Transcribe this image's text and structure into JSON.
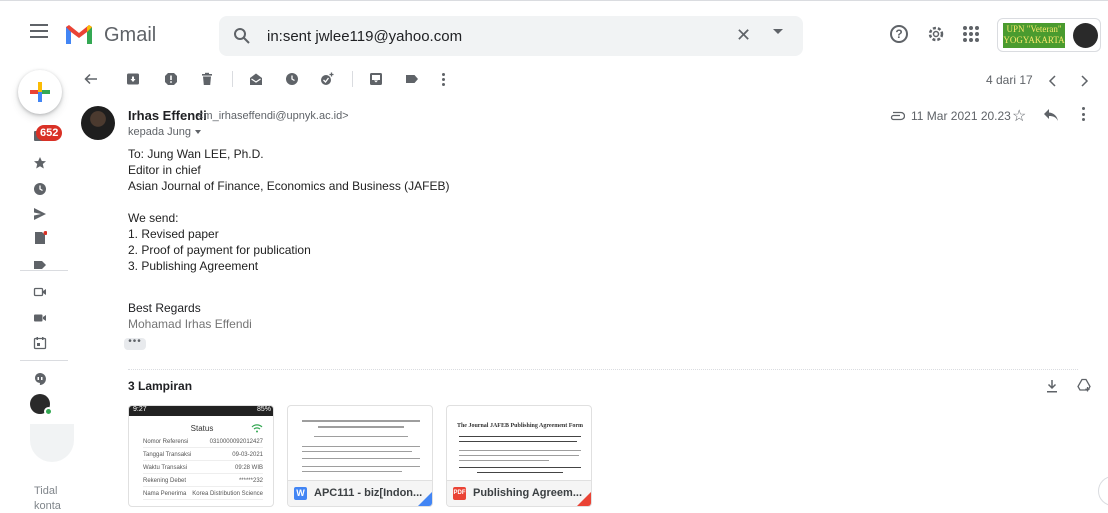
{
  "app": {
    "brand": "Gmail",
    "colors": {
      "accent_red": "#ea4335",
      "badge_red": "#d93025",
      "org_green": "#4a9b2f",
      "org_yellow": "#f7e76b"
    }
  },
  "search": {
    "value": "in:sent jwlee119@yahoo.com",
    "clear": "✕"
  },
  "org": {
    "line1": "UPN \"Veteran\"",
    "line2": "YOGYAKARTA"
  },
  "rail": {
    "inbox_count": "652",
    "icons": [
      "inbox-icon",
      "star-icon",
      "clock-icon",
      "send-icon",
      "draft-icon",
      "label-icon",
      "meet-new-icon",
      "meet-join-icon",
      "calendar-icon",
      "hangouts-icon"
    ],
    "hint_line1": "Tidal",
    "hint_line2": "konta"
  },
  "toolbar": {
    "icons": [
      "back-icon",
      "archive-icon",
      "report-spam-icon",
      "delete-icon",
      "mark-unread-icon",
      "snooze-icon",
      "add-task-icon",
      "move-to-icon",
      "labels-icon",
      "more-icon"
    ],
    "page_count": "4 dari 17"
  },
  "message": {
    "sender_name": "Irhas Effendi",
    "sender_email": "<m_irhaseffendi@upnyk.ac.id>",
    "recipient": "kepada Jung",
    "date": "11 Mar 2021 20.23",
    "body": [
      "To: Jung Wan LEE, Ph.D.",
      "Editor in chief",
      "Asian Journal of Finance, Economics and Business (JAFEB)",
      "",
      "We send:",
      "1. Revised paper",
      "2. Proof of payment for publication",
      "3. Publishing Agreement"
    ],
    "sign_off": "Best Regards",
    "sign_name": "Mohamad Irhas Effendi",
    "trimmed": "•••"
  },
  "attachments": {
    "title": "3 Lampiran",
    "items": [
      {
        "type": "image",
        "status_time": "9:27",
        "status_right": "85%",
        "screen_title": "Status",
        "rows": [
          {
            "label": "Nomor Referensi",
            "value": "0310000092012427"
          },
          {
            "label": "Tanggal Transaksi",
            "value": "09-03-2021"
          },
          {
            "label": "Waktu Transaksi",
            "value": "09:28 WIB"
          },
          {
            "label": "Rekening Debet",
            "value": "******232"
          },
          {
            "label": "Nama Penerima",
            "value": "Korea Distribution Science"
          }
        ]
      },
      {
        "type": "word",
        "badge": "W",
        "name": "APC111 - biz[Indon...",
        "badge_color": "#4285f4",
        "corner_color": "#4285f4"
      },
      {
        "type": "pdf",
        "badge": "PDF",
        "name": "Publishing Agreem...",
        "badge_color": "#ea4335",
        "corner_color": "#ea4335",
        "preview_title": "The Journal JAFEB Publishing Agreement Form"
      }
    ]
  }
}
